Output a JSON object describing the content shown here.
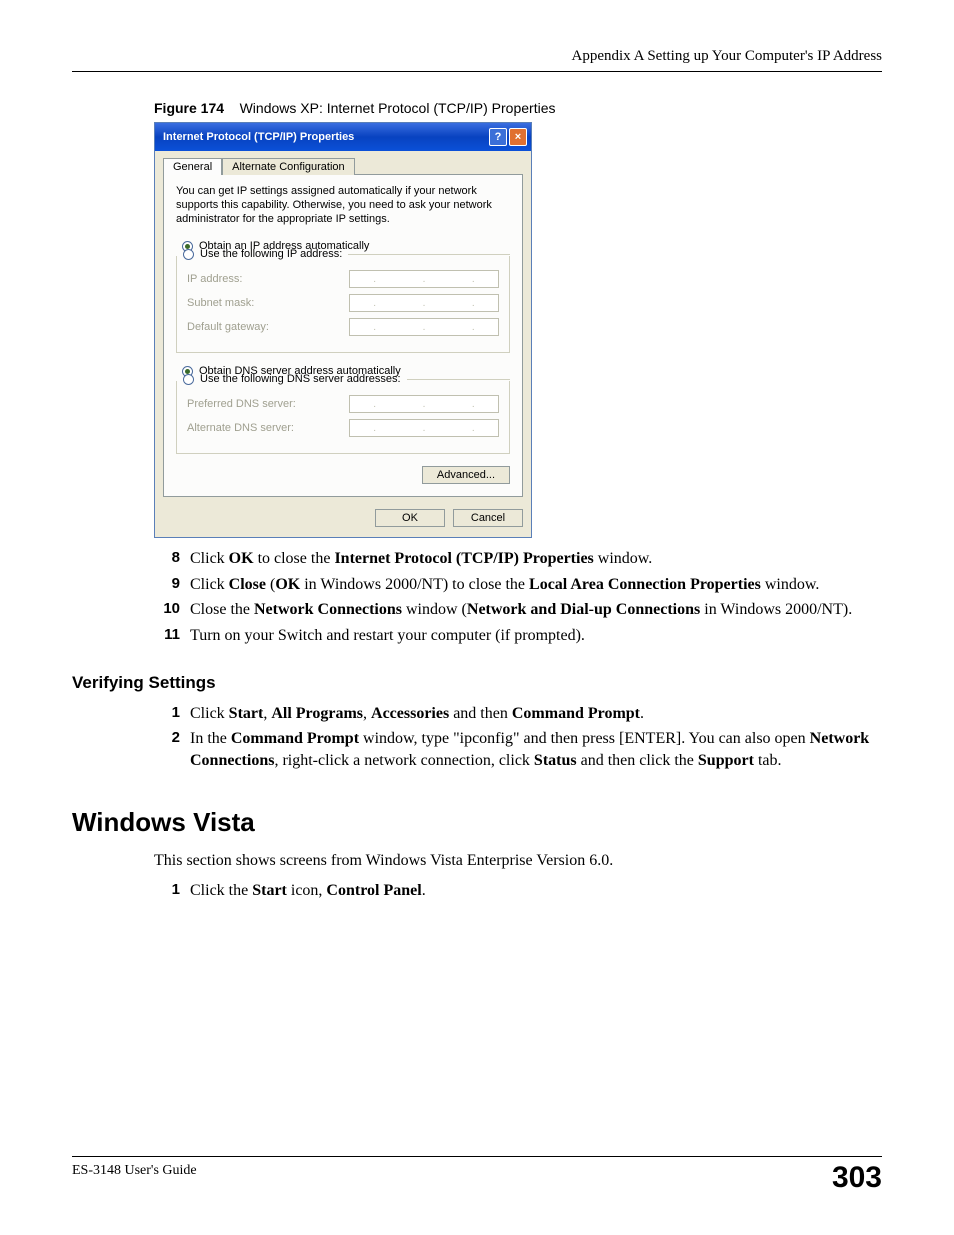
{
  "header": {
    "text": "Appendix A Setting up Your Computer's IP Address"
  },
  "figure": {
    "label": "Figure 174",
    "caption": "Windows XP: Internet Protocol (TCP/IP) Properties"
  },
  "dialog": {
    "title": "Internet Protocol (TCP/IP) Properties",
    "help_btn": "?",
    "close_btn": "×",
    "tabs": {
      "general": "General",
      "alt": "Alternate Configuration"
    },
    "explain": "You can get IP settings assigned automatically if your network supports this capability. Otherwise, you need to ask your network administrator for the appropriate IP settings.",
    "radio_ip_auto": "Obtain an IP address automatically",
    "radio_ip_manual": "Use the following IP address:",
    "ip_label": "IP address:",
    "subnet_label": "Subnet mask:",
    "gateway_label": "Default gateway:",
    "radio_dns_auto": "Obtain DNS server address automatically",
    "radio_dns_manual": "Use the following DNS server addresses:",
    "pref_dns_label": "Preferred DNS server:",
    "alt_dns_label": "Alternate DNS server:",
    "advanced_btn": "Advanced...",
    "ok_btn": "OK",
    "cancel_btn": "Cancel"
  },
  "steps_a": {
    "s8": {
      "num": "8",
      "pre": "Click ",
      "b1": "OK",
      "mid": " to close the ",
      "b2": "Internet Protocol (TCP/IP) Properties",
      "post": " window."
    },
    "s9": {
      "num": "9",
      "pre": "Click ",
      "b1": "Close",
      "mid1": " (",
      "b2": "OK",
      "mid2": " in Windows 2000/NT) to close the ",
      "b3": "Local Area Connection Properties",
      "post": " window."
    },
    "s10": {
      "num": "10",
      "pre": "Close the ",
      "b1": "Network Connections",
      "mid": " window (",
      "b2": "Network and Dial-up Connections",
      "post": " in Windows 2000/NT)."
    },
    "s11": {
      "num": "11",
      "text": "Turn on your Switch and restart your computer (if prompted)."
    }
  },
  "verify": {
    "heading": "Verifying Settings",
    "s1": {
      "num": "1",
      "pre": "Click ",
      "b1": "Start",
      "c1": ", ",
      "b2": "All Programs",
      "c2": ", ",
      "b3": "Accessories",
      "mid": " and then ",
      "b4": "Command Prompt",
      "post": "."
    },
    "s2": {
      "num": "2",
      "pre": "In the ",
      "b1": "Command Prompt",
      "mid1": " window, type \"ipconfig\" and then press [ENTER]. You can also open ",
      "b2": "Network Connections",
      "mid2": ", right-click a network connection, click ",
      "b3": "Status",
      "mid3": " and then click the ",
      "b4": "Support",
      "post": " tab."
    }
  },
  "vista": {
    "heading": "Windows Vista",
    "intro": "This section shows screens from Windows Vista Enterprise Version 6.0.",
    "s1": {
      "num": "1",
      "pre": "Click the ",
      "b1": "Start",
      "mid": " icon, ",
      "b2": "Control Panel",
      "post": "."
    }
  },
  "footer": {
    "guide": "ES-3148 User's Guide",
    "page": "303"
  }
}
